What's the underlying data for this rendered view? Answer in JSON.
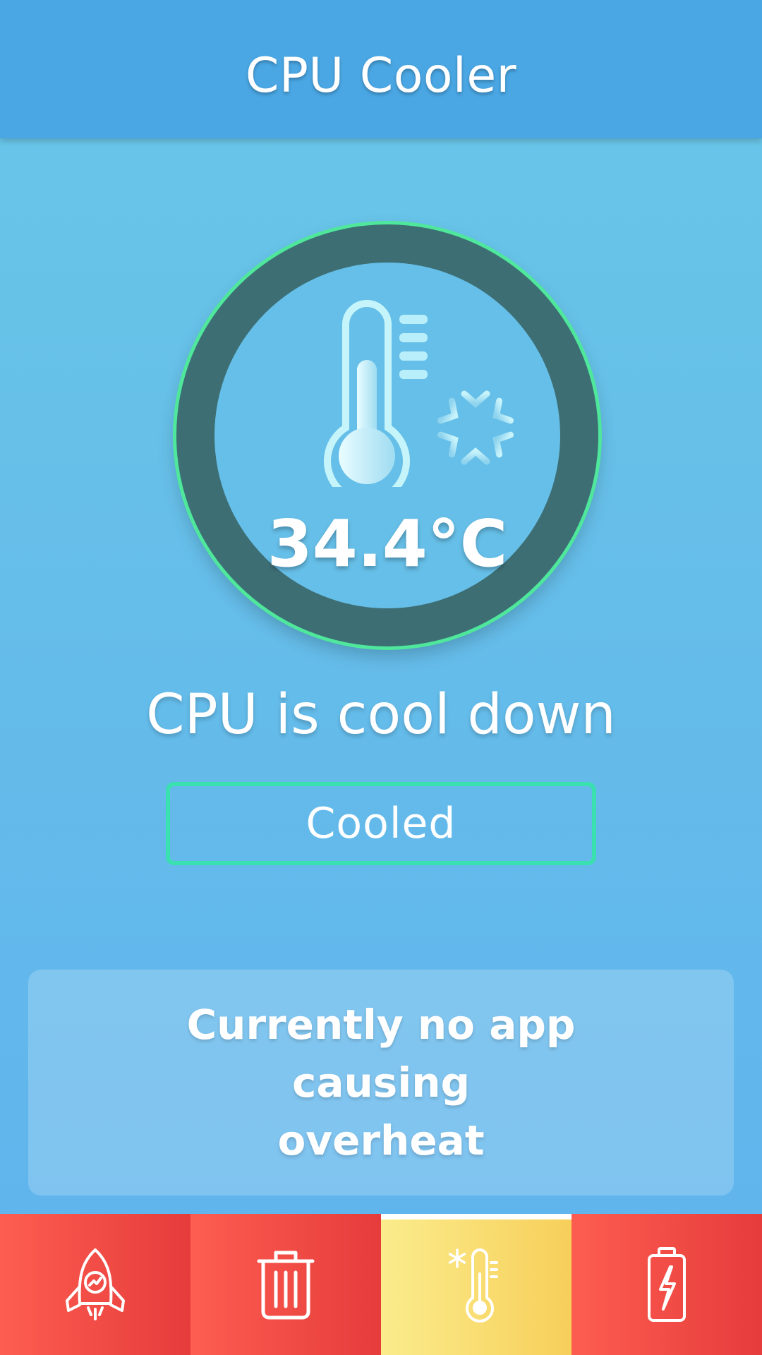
{
  "header": {
    "title": "CPU Cooler"
  },
  "gauge": {
    "temperature": "34.4°C",
    "icon": "thermometer-snowflake-icon"
  },
  "status": {
    "text": "CPU is cool down"
  },
  "action": {
    "label": "Cooled"
  },
  "info_card": {
    "line1": "Currently no app",
    "line2": "causing overheat"
  },
  "bottom_nav": {
    "items": [
      {
        "icon": "rocket-icon",
        "active": false
      },
      {
        "icon": "trash-icon",
        "active": false
      },
      {
        "icon": "thermometer-snowflake-icon",
        "active": true
      },
      {
        "icon": "battery-charging-icon",
        "active": false
      }
    ]
  },
  "colors": {
    "header": "#4aa7e4",
    "background": "#65bde9",
    "gauge_ring": "#3d6e74",
    "gauge_glow": "#4fe79c",
    "button_border": "#3be0b0",
    "nav_inactive": "#f04a45",
    "nav_active": "#f9de72"
  }
}
